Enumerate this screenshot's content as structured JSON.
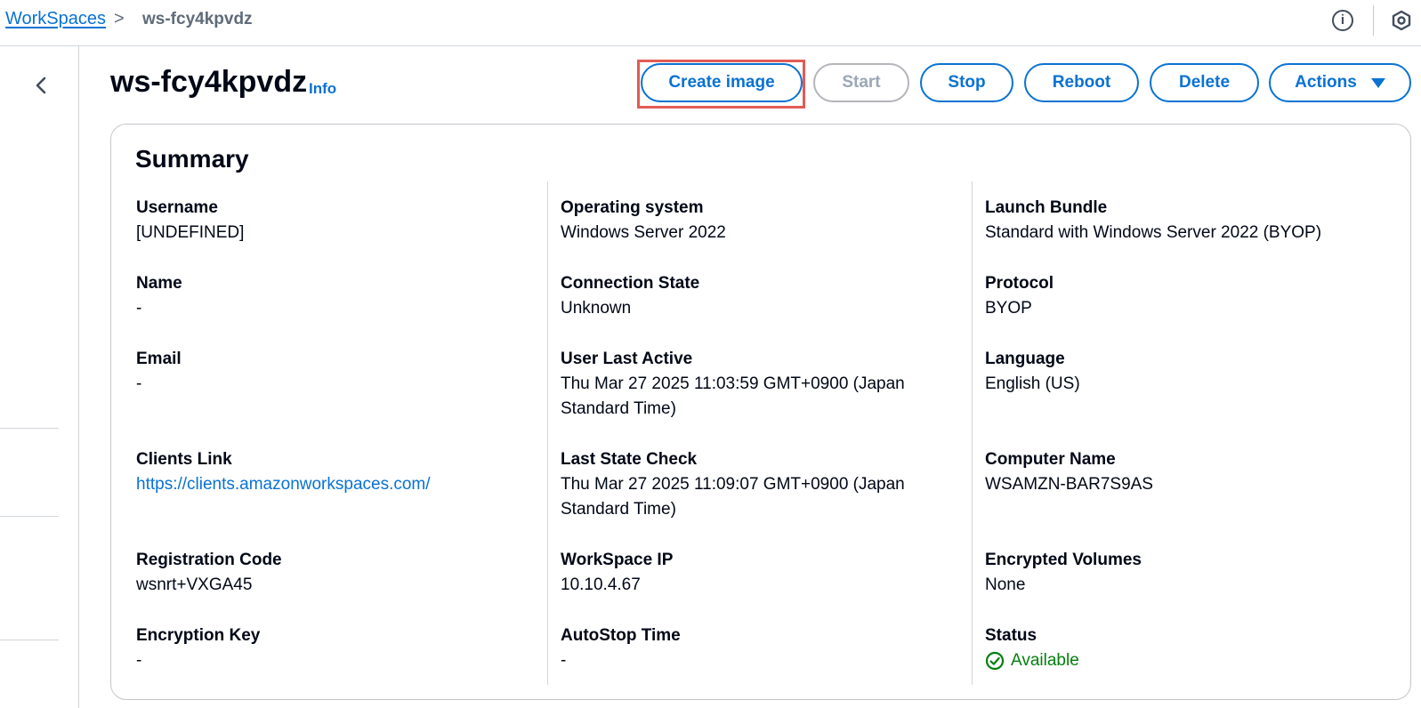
{
  "breadcrumb": {
    "root": "WorkSpaces",
    "separator": ">",
    "current": "ws-fcy4kpvdz"
  },
  "topbar": {
    "info_icon": "info-circle-icon",
    "settings_icon": "hexagon-settings-icon"
  },
  "header": {
    "title": "ws-fcy4kpvdz",
    "info_label": "Info"
  },
  "actions": {
    "create_image": "Create image",
    "start": "Start",
    "stop": "Stop",
    "reboot": "Reboot",
    "delete": "Delete",
    "actions": "Actions"
  },
  "colors": {
    "accent": "#0972d3",
    "highlight_border": "#e25b55",
    "status_available": "#037f0c",
    "disabled": "#9ba7b6"
  },
  "summary": {
    "title": "Summary",
    "col1": [
      {
        "label": "Username",
        "value": "[UNDEFINED]"
      },
      {
        "label": "Name",
        "value": "-"
      },
      {
        "label": "Email",
        "value": "-"
      },
      {
        "label": "Clients Link",
        "value": "https://clients.amazonworkspaces.com/"
      },
      {
        "label": "Registration Code",
        "value": "wsnrt+VXGA45"
      },
      {
        "label": "Encryption Key",
        "value": "-"
      }
    ],
    "col2": [
      {
        "label": "Operating system",
        "value": "Windows Server 2022"
      },
      {
        "label": "Connection State",
        "value": "Unknown"
      },
      {
        "label": "User Last Active",
        "value": "Thu Mar 27 2025 11:03:59 GMT+0900 (Japan Standard Time)"
      },
      {
        "label": "Last State Check",
        "value": "Thu Mar 27 2025 11:09:07 GMT+0900 (Japan Standard Time)"
      },
      {
        "label": "WorkSpace IP",
        "value": "10.10.4.67"
      },
      {
        "label": "AutoStop Time",
        "value": "-"
      }
    ],
    "col3": [
      {
        "label": "Launch Bundle",
        "value": "Standard with Windows Server 2022 (BYOP)"
      },
      {
        "label": "Protocol",
        "value": "BYOP"
      },
      {
        "label": "Language",
        "value": "English (US)"
      },
      {
        "label": "Computer Name",
        "value": "WSAMZN-BAR7S9AS"
      },
      {
        "label": "Encrypted Volumes",
        "value": "None"
      },
      {
        "label": "Status",
        "value": "Available",
        "icon": "check-circle-icon"
      }
    ]
  }
}
